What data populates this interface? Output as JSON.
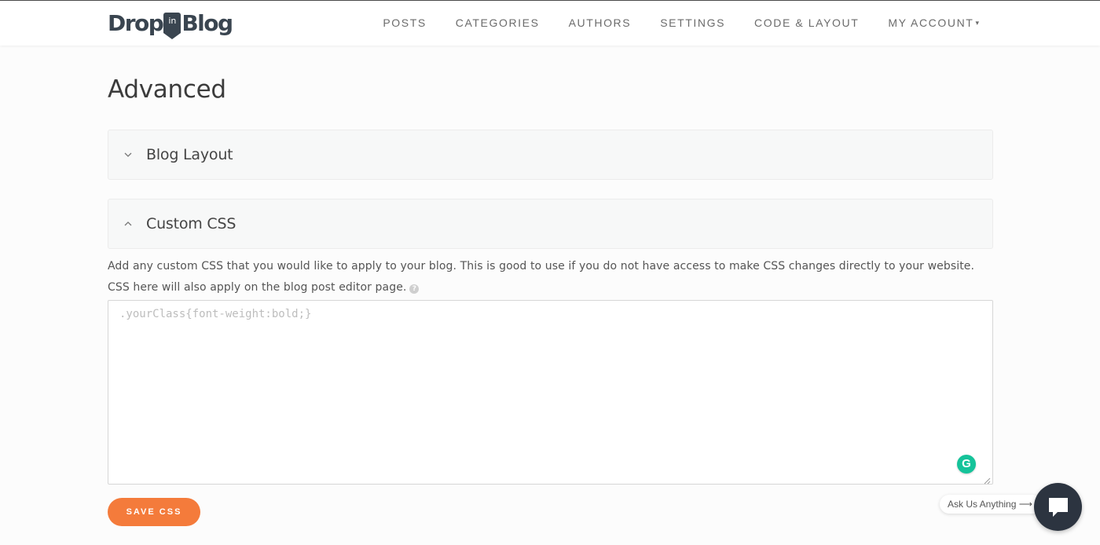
{
  "brand": {
    "logo_left": "Drop",
    "logo_pin": "in",
    "logo_right": "Blog",
    "accent_color": "#f47b3b",
    "dark_color": "#3a4550"
  },
  "nav": {
    "items": [
      {
        "label": "POSTS"
      },
      {
        "label": "CATEGORIES"
      },
      {
        "label": "AUTHORS"
      },
      {
        "label": "SETTINGS"
      },
      {
        "label": "CODE & LAYOUT"
      },
      {
        "label": "MY ACCOUNT"
      }
    ],
    "account_caret": "▾"
  },
  "page": {
    "title": "Advanced"
  },
  "panels": {
    "blog_layout": {
      "title": "Blog Layout",
      "state": "collapsed"
    },
    "custom_css": {
      "title": "Custom CSS",
      "state": "expanded"
    }
  },
  "custom_css": {
    "description": "Add any custom CSS that you would like to apply to your blog. This is good to use if you do not have access to make CSS changes directly to your website. CSS here will also apply on the blog post editor page.",
    "help_icon_glyph": "?",
    "editor_value": "",
    "editor_placeholder": ".yourClass{font-weight:bold;}",
    "save_label": "SAVE CSS"
  },
  "widgets": {
    "grammarly_glyph": "G",
    "ask_label": "Ask Us Anything",
    "ask_arrow": "⟶"
  }
}
